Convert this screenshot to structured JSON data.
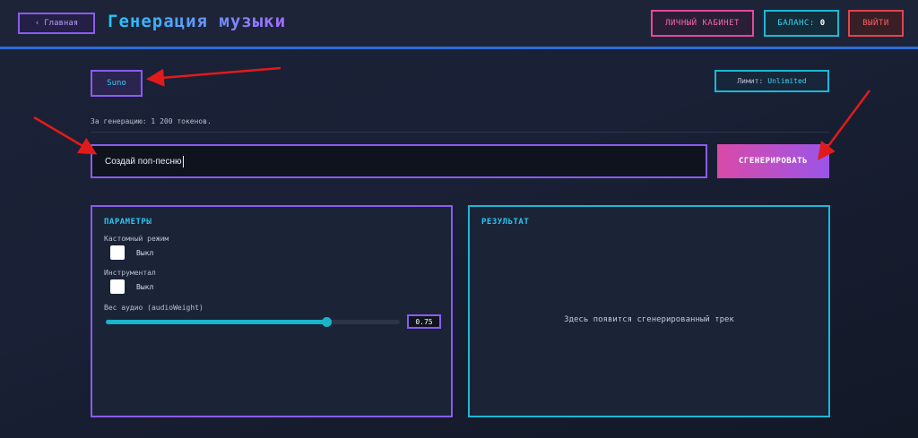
{
  "header": {
    "back_label": "Главная",
    "title": "Генерация музыки",
    "cabinet_label": "ЛИЧНЫЙ КАБИНЕТ",
    "balance_label": "БАЛАНС:",
    "balance_value": "0",
    "logout_label": "ВЫЙТИ"
  },
  "engine": {
    "label": "Suno"
  },
  "limit": {
    "label": "Лимит:",
    "value": "Unlimited"
  },
  "cost_text": "За генерацию: 1 200 токенов.",
  "prompt": {
    "value": "Создай поп-песню",
    "generate_label": "СГЕНЕРИРОВАТЬ"
  },
  "params": {
    "title": "ПАРАМЕТРЫ",
    "custom_mode_label": "Кастомный режим",
    "custom_mode_state": "Выкл",
    "instrumental_label": "Инструментал",
    "instrumental_state": "Выкл",
    "audio_weight_label": "Вес аудио (audioWeight)",
    "audio_weight_value": "0.75",
    "audio_weight": 0.75
  },
  "result": {
    "title": "РЕЗУЛЬТАТ",
    "placeholder": "Здесь появится сгенерированный трек"
  },
  "colors": {
    "accent_purple": "#8a5cf0",
    "accent_cyan": "#1bb8d6",
    "accent_pink": "#e04a9c",
    "accent_red": "#e0454a",
    "annotation_arrow": "#e01b1b"
  },
  "icons": {
    "back": "chevron-left-icon"
  }
}
